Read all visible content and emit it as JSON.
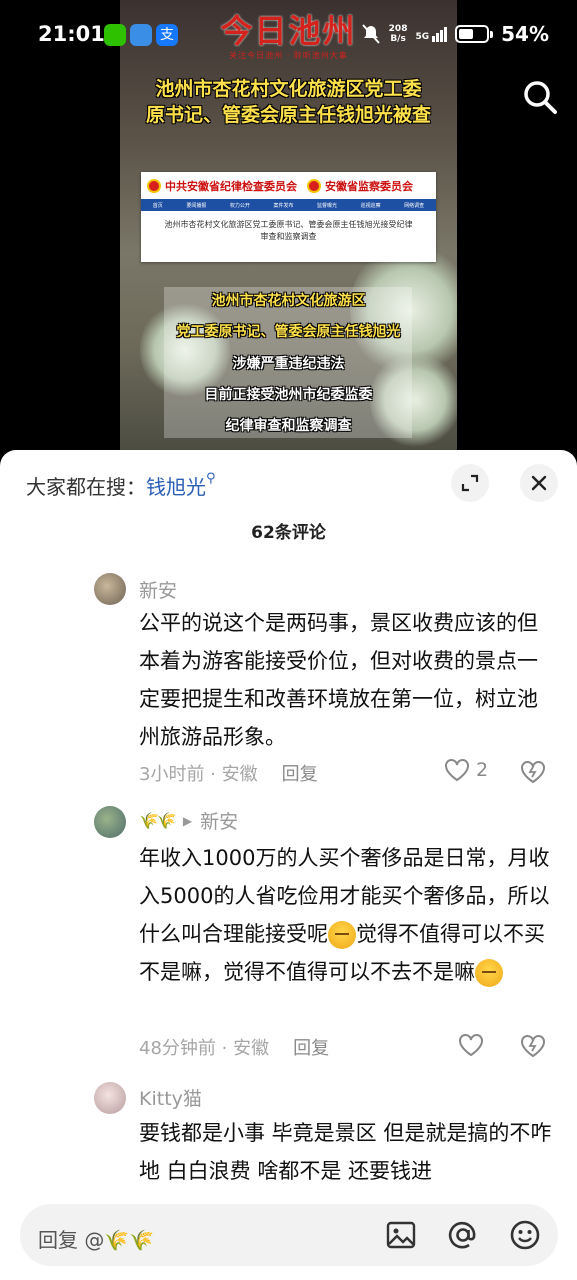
{
  "status_bar": {
    "time": "21:01",
    "network_speed": "208\nB/s",
    "network_type": "5G",
    "battery": "54%",
    "battery_level": 0.54
  },
  "video": {
    "channel_logo": "今日池州",
    "channel_slogan": "关注今日池州 · 聆听池州大事",
    "headline_line1": "池州市杏花村文化旅游区党工委",
    "headline_line2": "原书记、管委会原主任钱旭光被查",
    "card": {
      "org1": "中共安徽省纪律检查委员会",
      "org2": "安徽省监察委员会",
      "nav": [
        "首页",
        "要闻播报",
        "权力公开",
        "案件发布",
        "监督曝光",
        "巡视巡察",
        "网络调查"
      ],
      "text": "池州市杏花村文化旅游区党工委原书记、管委会原主任钱旭光接受纪律审查和监察调查"
    },
    "overlay_lines": [
      {
        "text": "池州市杏花村文化旅游区",
        "color": "yellow"
      },
      {
        "text": "党工委原书记、管委会原主任钱旭光",
        "color": "yellow"
      },
      {
        "text": "涉嫌严重违纪违法",
        "color": "white"
      },
      {
        "text": "目前正接受池州市纪委监委",
        "color": "white"
      },
      {
        "text": "纪律审查和监察调查",
        "color": "white"
      }
    ]
  },
  "sheet": {
    "hot_search_label": "大家都在搜：",
    "hot_search_term": "钱旭光",
    "comment_count": "62条评论"
  },
  "comments": [
    {
      "user": "新安",
      "reply_to": "",
      "text": "公平的说这个是两码事，景区收费应该的但本着为游客能接受价位，但对收费的景点一定要把提生和改善环境放在第一位，树立池州旅游品形象。",
      "time": "3小时前",
      "location": "安徽",
      "reply_label": "回复",
      "likes": "2"
    },
    {
      "user": "🌾🌾",
      "reply_to": "新安",
      "text_part1": "年收入1000万的人买个奢侈品是日常，月收入5000的人省吃俭用才能买个奢侈品，所以什么叫合理能接受呢",
      "text_part2": "觉得不值得可以不买不是嘛，觉得不值得可以不去不是嘛",
      "time": "48分钟前",
      "location": "安徽",
      "reply_label": "回复",
      "likes": ""
    },
    {
      "user": "Kitty猫",
      "reply_to": "",
      "text": "要钱都是小事 毕竟是景区  但是就是搞的不咋地 白白浪费  啥都不是  还要钱进",
      "time": "",
      "location": "",
      "reply_label": "",
      "likes": ""
    }
  ],
  "input": {
    "placeholder": "回复 @🌾🌾"
  },
  "colors": {
    "accent_blue": "#2b5eb5",
    "headline_yellow": "#ffe14b",
    "logo_red": "#d4231c"
  },
  "icons": [
    "wechat-icon",
    "app-icon",
    "alipay-icon",
    "mute-icon",
    "signal-icon",
    "battery-icon",
    "search-icon",
    "expand-icon",
    "close-icon",
    "heart-icon",
    "dislike-heart-icon",
    "image-icon",
    "at-icon",
    "emoji-icon"
  ]
}
